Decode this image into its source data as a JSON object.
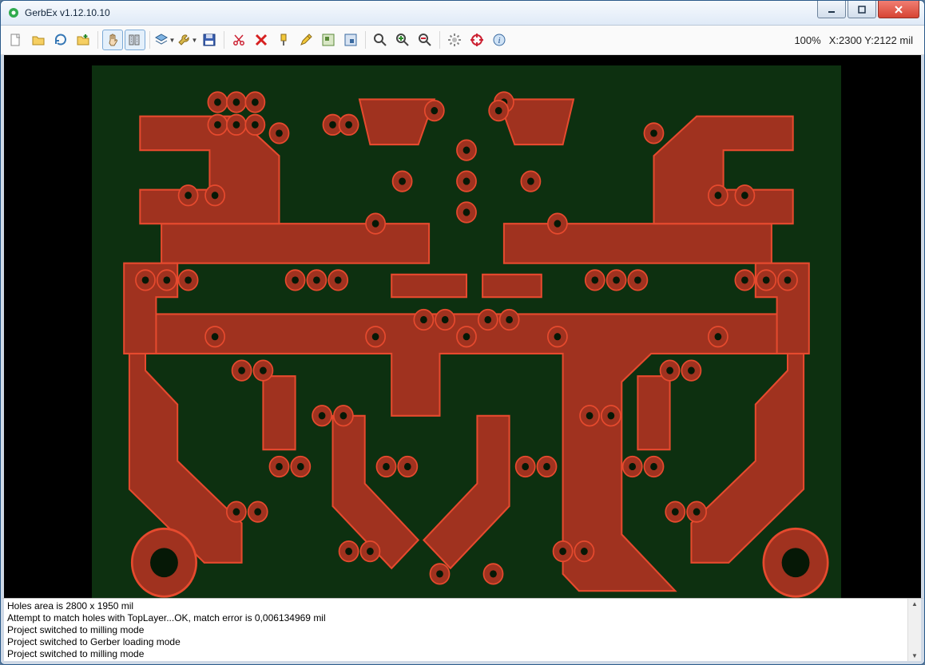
{
  "window": {
    "title": "GerbEx v1.12.10.10"
  },
  "caption_buttons": {
    "minimize": "minimize",
    "maximize": "maximize",
    "close": "close"
  },
  "toolbar": {
    "zoom_label": "100%",
    "coord_label": "X:2300 Y:2122 mil",
    "buttons": [
      {
        "id": "new-file-button",
        "icon": "file-new-icon"
      },
      {
        "id": "open-file-button",
        "icon": "folder-open-icon"
      },
      {
        "id": "reload-button",
        "icon": "reload-icon"
      },
      {
        "id": "folder-add-button",
        "icon": "folder-add-icon"
      },
      {
        "sep": true
      },
      {
        "id": "pan-button",
        "icon": "hand-icon",
        "selected": true
      },
      {
        "id": "measure-button",
        "icon": "measure-icon",
        "selected": true
      },
      {
        "sep": true
      },
      {
        "id": "layers-button",
        "icon": "layers-icon",
        "dropdown": true
      },
      {
        "id": "tools-button",
        "icon": "wrench-icon",
        "dropdown": true
      },
      {
        "id": "save-button",
        "icon": "floppy-icon"
      },
      {
        "sep": true
      },
      {
        "id": "cut-button",
        "icon": "scissors-icon"
      },
      {
        "id": "delete-button",
        "icon": "x-red-icon"
      },
      {
        "id": "drill-button",
        "icon": "drill-icon"
      },
      {
        "id": "pencil-button",
        "icon": "pencil-icon"
      },
      {
        "id": "area1-button",
        "icon": "area1-icon"
      },
      {
        "id": "area2-button",
        "icon": "area2-icon"
      },
      {
        "sep": true
      },
      {
        "id": "zoom-button",
        "icon": "magnifier-icon"
      },
      {
        "id": "zoom-in-button",
        "icon": "zoom-in-icon"
      },
      {
        "id": "zoom-out-button",
        "icon": "zoom-out-icon"
      },
      {
        "sep": true
      },
      {
        "id": "settings-button",
        "icon": "gear-icon"
      },
      {
        "id": "origin-button",
        "icon": "crosshair-icon"
      },
      {
        "id": "info-button",
        "icon": "info-icon"
      }
    ]
  },
  "board": {
    "substrate_color": "#0d3010",
    "copper_color": "#a0321f",
    "outline_color": "#e64a2e"
  },
  "log": {
    "lines": [
      "Holes area is 2800 x 1950 mil",
      "Attempt to match holes with TopLayer...OK, match error is 0,006134969 mil",
      "Project switched to milling mode",
      "Project switched to Gerber loading mode",
      "Project switched to milling mode"
    ]
  }
}
